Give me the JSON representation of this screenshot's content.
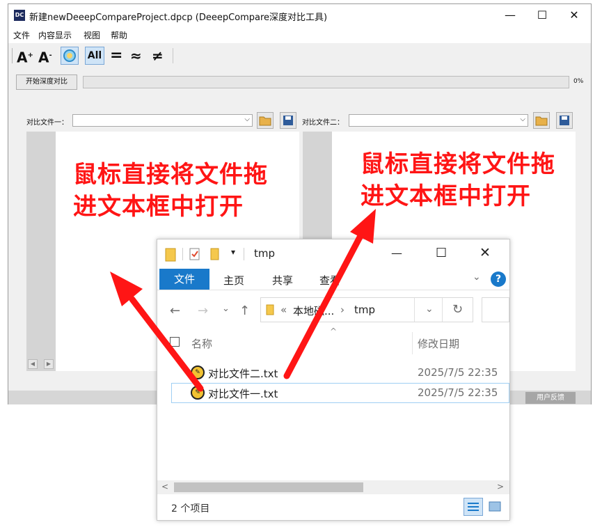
{
  "app": {
    "title": "新建newDeeepCompareProject.dpcp  (DeeepCompare深度对比工具)",
    "logo": "DC",
    "controls": {
      "minimize": "—",
      "maximize": "☐",
      "close": "✕"
    }
  },
  "menu": [
    "文件",
    "内容显示",
    "视图",
    "帮助"
  ],
  "toolbar": {
    "font_up": "A",
    "font_down": "A",
    "all": "All",
    "equal": "=",
    "approx": "≈",
    "not_equal": "≠"
  },
  "compare": {
    "start_button": "开始深度对比",
    "progress_percent": 0,
    "progress_label": "0%",
    "left_label": "对比文件一：",
    "right_label": "对比文件二："
  },
  "statusbar": {
    "feedback": "用户反馈"
  },
  "annotation": {
    "left_line1": "鼠标直接将文件拖",
    "left_line2": "进文本框中打开",
    "right_line1": "鼠标直接将文件拖",
    "right_line2": "进文本框中打开"
  },
  "explorer": {
    "title": "tmp",
    "tabs": [
      "文件",
      "主页",
      "共享",
      "查看"
    ],
    "path_prefix": "«",
    "path_parent": "本地磁...",
    "path_sep": "›",
    "path_current": "tmp",
    "col_name": "名称",
    "col_date": "修改日期",
    "files": [
      {
        "name": "对比文件二.txt",
        "date": "2025/7/5 22:35"
      },
      {
        "name": "对比文件一.txt",
        "date": "2025/7/5 22:35"
      }
    ],
    "item_count": "2 个项目",
    "help": "?"
  },
  "colors": {
    "annotation_red": "#ff1515",
    "ribbon_blue": "#1979ca"
  },
  "icons": [
    "folder-open-icon",
    "save-icon",
    "color-filter-icon",
    "help-icon",
    "txt-file-icon",
    "refresh-icon"
  ]
}
